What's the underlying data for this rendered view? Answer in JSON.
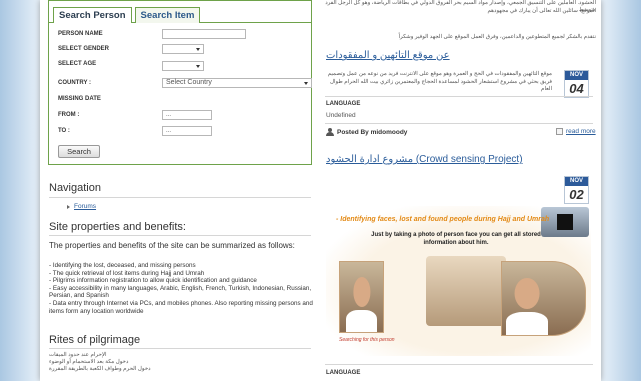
{
  "search": {
    "tab_person": "Search Person",
    "tab_item": "Search Item",
    "person_name_label": "PERSON NAME",
    "gender_label": "SELECT GENDER",
    "age_label": "SELECT AGE",
    "country_label": "COUNTRY :",
    "country_value": "Select Country",
    "missing_date_label": "MISSING DATE",
    "from_label": "FROM :",
    "from_value": "...",
    "to_label": "TO :",
    "to_value": "...",
    "search_button": "Search"
  },
  "navigation": {
    "title": "Navigation",
    "forums_link": "Forums"
  },
  "site_properties": {
    "title": "Site properties and benefits:",
    "intro": "The properties and benefits of the site can be summarized as follows:",
    "items": [
      "- Identifying the lost, deceased, and missing persons",
      "- The quick retrieval of lost items during Hajj and Umrah",
      "- Pilgrims information registration to allow quick identification and guidance",
      "- Easy accessibility in many languages, Arabic, English, French, Turkish, Indonesian, Russian, Persian, and Spanish",
      "- Data entry through Internet via PCs, and mobiles phones. Also reporting missing persons and items form any location worldwide"
    ]
  },
  "rites": {
    "title": "Rites of pilgrimage",
    "lines": [
      "الإحرام عند حدود الميقات",
      "دخول مكة بعد الاستحمام أو الوضوء",
      "دخول الحرم وطواف الكعبة بالطريقة المقررة"
    ]
  },
  "posts": {
    "top_text_1": "الحشود. العاملين على التنسيق الجمعي، وإصدار مواد السيم بحر الفروق الدولي في بطاقات الرياضة، وهو كل الرجل الفرد متوسط",
    "top_text_2": "الموقع، سائلين الله تعالى أن يبارك في مجهودهم",
    "top_text_3": "نتقدم بالشكر لجميع المتطوعين والداعمين، وفرق العمل الموقع على الجهد الوفير وشكراً",
    "post1": {
      "title": "عن موقع التائهين و المفقودات",
      "body_1": "موقع التائهين والمفقودات في الحج و العمرة وهو موقع على الانترنت فريد من نوعه من عمل وتصميم",
      "body_2": "فريق بحثي في مشروع استشعار الحشود لمساعدة الحجاج والمعتمرين زائري بيت الله الحرام طوال العام",
      "month": "NOV",
      "day": "04",
      "language_label": "LANGUAGE",
      "language_value": "Undefined",
      "posted_by": "Posted By midomoody",
      "read_more": "read more"
    },
    "post2": {
      "title": "مشروع ادارة الحشود (Crowd sensing Project)",
      "month": "NOV",
      "day": "02",
      "promo_title": "- Identifying faces, lost and found people during Hajj and Umrah",
      "promo_sub": "Just by taking a photo of person face you can get all stored information about him.",
      "promo_caption": "Searching for this person",
      "language_label": "LANGUAGE"
    }
  }
}
